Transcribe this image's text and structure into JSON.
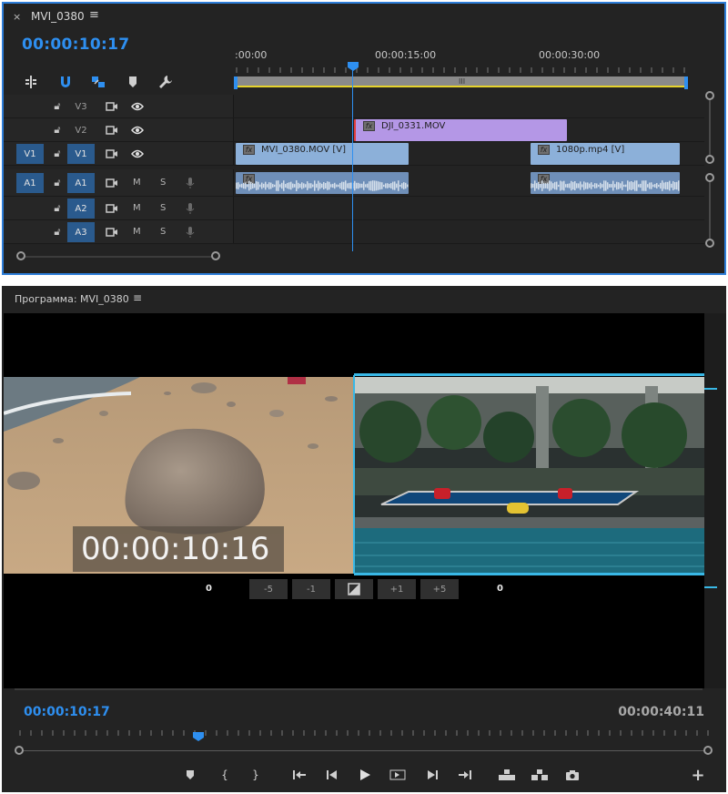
{
  "timeline": {
    "close_label": "×",
    "title": "MVI_0380",
    "menu_icon": "hamburger-icon",
    "timecode": "00:00:10:17",
    "ruler_labels": [
      ":00:00",
      "00:00:15:00",
      "00:00:30:00"
    ],
    "work_bar_grip": "III",
    "tracks": [
      {
        "id": "V3",
        "label": "V3"
      },
      {
        "id": "V2",
        "label": "V2"
      },
      {
        "id": "V1",
        "label": "V1",
        "source": "V1"
      },
      {
        "id": "A1",
        "label": "A1",
        "source": "A1",
        "m": "M",
        "s": "S"
      },
      {
        "id": "A2",
        "label": "A2",
        "m": "M",
        "s": "S"
      },
      {
        "id": "A3",
        "label": "A3",
        "m": "M",
        "s": "S"
      }
    ],
    "clips": {
      "dji": "DJI_0331.MOV",
      "mvi": "MVI_0380.MOV [V]",
      "p1080": "1080p.mp4 [V]",
      "fx": "fx"
    }
  },
  "program": {
    "title": "Программа: MVI_0380",
    "overlay_timecode": "00:00:10:16",
    "trim": {
      "left_value": "0",
      "right_value": "0",
      "buttons": [
        "-5",
        "-1",
        "+1",
        "+5"
      ]
    },
    "current_time": "00:00:10:17",
    "duration": "00:00:40:11",
    "plus_label": "+"
  },
  "colors": {
    "accent": "#2e8ff0",
    "video_clip": "#8cb0d9",
    "purple_clip": "#b497e6",
    "audio_clip": "#6f8fb8",
    "work_area_line": "#e6d32d"
  }
}
